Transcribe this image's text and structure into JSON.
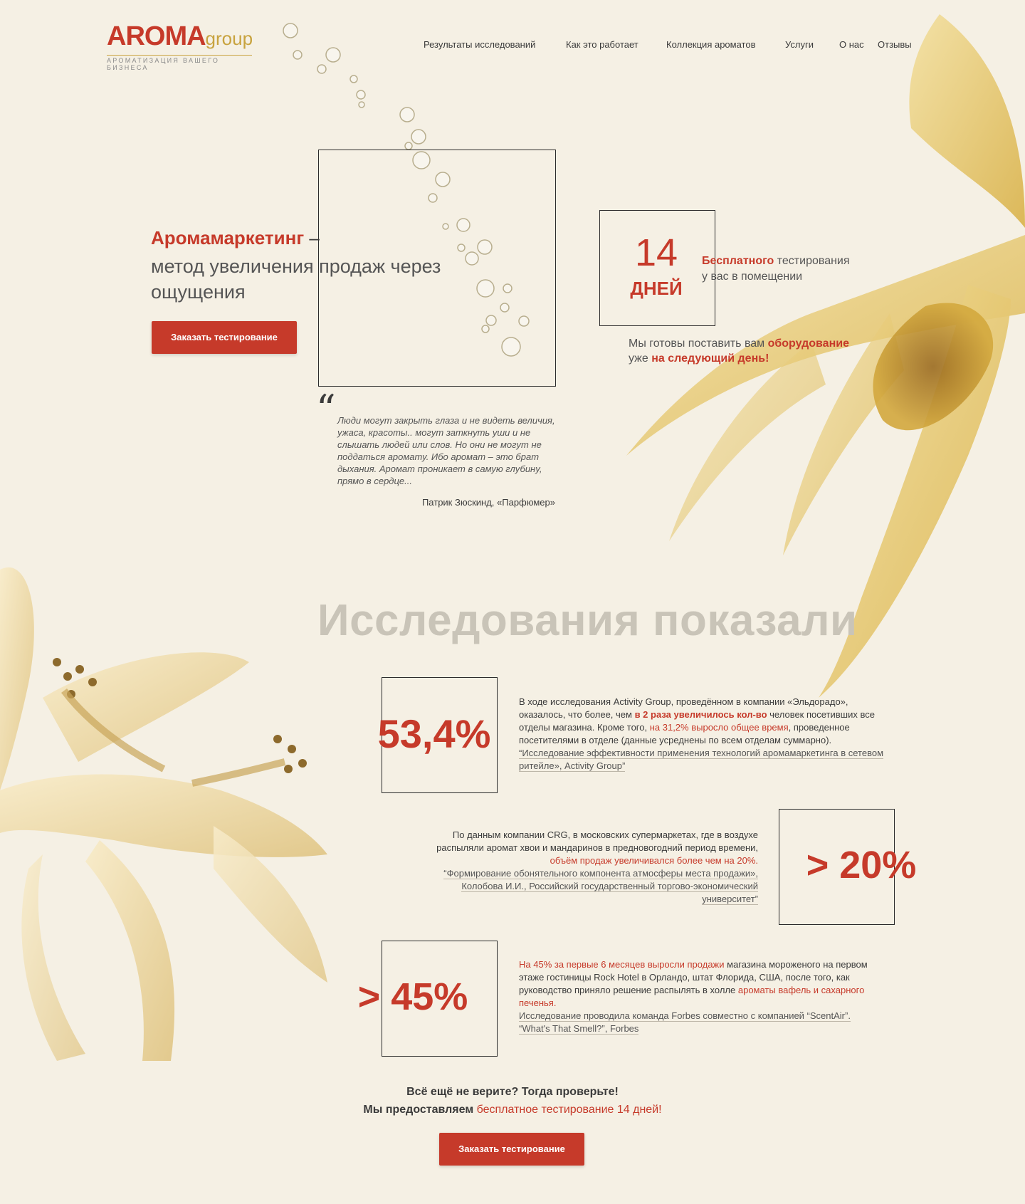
{
  "logo": {
    "main": "AROMA",
    "group": "group",
    "tagline": "АРОМАТИЗАЦИЯ ВАШЕГО БИЗНЕСА"
  },
  "nav": [
    "Результаты исследований",
    "Как это работает",
    "Коллекция ароматов",
    "Услуги",
    "О нас",
    "Отзывы"
  ],
  "hero": {
    "title_accent": "Аромамаркетинг",
    "title_dash": " –",
    "subtitle": "метод увеличения продаж через ощущения",
    "button": "Заказать тестирование"
  },
  "trial": {
    "number": "14",
    "unit": "ДНЕЙ",
    "desc_accent": "Бесплатного",
    "desc_rest": " тестирования",
    "desc_line2": "у вас в помещении",
    "equip_pre": "Мы готовы поставить вам ",
    "equip_accent": "оборудование",
    "equip_line2_pre": "уже ",
    "equip_line2_accent": "на следующий день!"
  },
  "quote": {
    "mark": "“",
    "text": "Люди могут закрыть глаза и не видеть величия, ужаса, красоты.. могут заткнуть уши и не слышать людей или слов. Но они не могут не поддаться аромату. Ибо аромат – это брат дыхания. Аромат проникает в самую глубину, прямо в сердце...",
    "author": "Патрик Зюскинд, «Парфюмер»"
  },
  "research": {
    "title": "Исследования показали",
    "stats": [
      {
        "value": "53,4%",
        "t1": "В ходе исследования Activity Group, проведённом в компании «Эльдорадо», оказалось, что более, чем ",
        "t1_accent": "в 2 раза увеличилось кол-во",
        "t2": " человек посетивших все отделы магазина. Кроме того, ",
        "t2_accent": "на 31,2% выросло общее время",
        "t3": ", проведенное посетителями в отделе (данные усреднены по всем отделам суммарно).",
        "source": "“Исследование эффективности применения технологий аромамаркетинга в сетевом ритейле», Activity Group”"
      },
      {
        "value": "> 20%",
        "t1": "По данным компании CRG, в московских супермаркетах, где в воздухе распыляли аромат хвои и мандаринов в предновогодний период времени, ",
        "t1_accent": "объём продаж увеличивался более чем на 20%.",
        "source": "“Формирование обонятельного компонента атмосферы места продажи», Колобова И.И., Российский государственный торгово-экономический университет”"
      },
      {
        "value": "> 45%",
        "t1_accent": "На 45% за первые 6 месяцев выросли продажи",
        "t1": " магазина мороженого на первом этаже гостиницы Rock Hotel в Орландо, штат Флорида, США, после того, как руководство приняло решение распылять в холле ",
        "t2_accent": "ароматы вафель и сахарного печенья.",
        "source1": "Исследование проводила команда Forbes совместно с компанией “ScentAir”.",
        "source2": "“What's That Smell?”, Forbes"
      }
    ]
  },
  "cta": {
    "line1": "Всё ещё не верите? Тогда проверьте!",
    "line2_pre": "Мы предоставляем ",
    "line2_accent": "бесплатное тестирование 14 дней!",
    "button": "Заказать тестирование"
  },
  "colors": {
    "accent": "#c63a2a",
    "gold": "#c8a33f",
    "background": "#f5f0e4"
  }
}
